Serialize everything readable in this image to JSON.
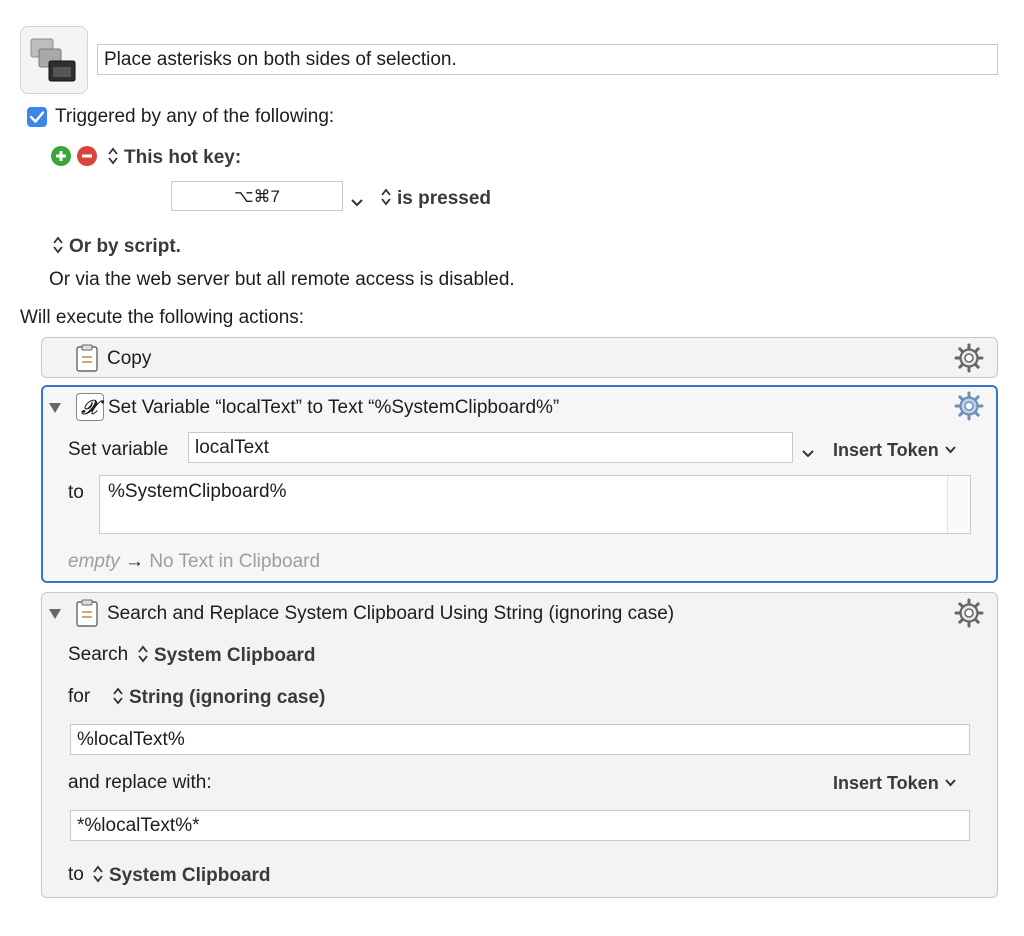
{
  "macro": {
    "title": "Place asterisks on both sides of selection."
  },
  "triggers": {
    "checkbox_label": "Triggered by any of the following:",
    "hotkey_label": "This hot key:",
    "hotkey_value": "⌥⌘7",
    "pressed_label": "is pressed",
    "script_label": "Or by script.",
    "web_server_text": "Or via the web server but all remote access is disabled."
  },
  "actions_header": "Will execute the following actions:",
  "actions": {
    "copy": {
      "title": "Copy"
    },
    "set_variable": {
      "title": "Set Variable “localText” to Text “%SystemClipboard%”",
      "set_label": "Set variable",
      "variable_name": "localText",
      "insert_token": "Insert Token",
      "to_label": "to",
      "to_value": "%SystemClipboard%",
      "preview_empty": "empty",
      "preview_arrow": "→",
      "preview_text": "No Text in Clipboard"
    },
    "search_replace": {
      "title": "Search and Replace System Clipboard Using String (ignoring case)",
      "search_label": "Search",
      "search_source": "System Clipboard",
      "for_label": "for",
      "for_mode": "String (ignoring case)",
      "search_value": "%localText%",
      "replace_label": "and replace with:",
      "insert_token": "Insert Token",
      "replace_value": "*%localText%*",
      "to_label": "to",
      "to_target": "System Clipboard"
    }
  },
  "colors": {
    "accent": "#3b73c8",
    "checkbox": "#3d86e8",
    "add": "#3aa63a",
    "remove": "#d9443c"
  }
}
